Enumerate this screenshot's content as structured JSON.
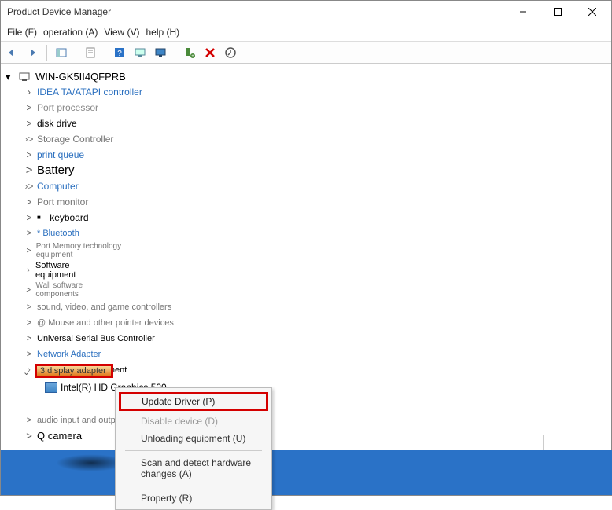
{
  "window": {
    "title": "Product Device Manager"
  },
  "menu": {
    "file": "File (F)",
    "operation": "operation (A)",
    "view": "View (V)",
    "help": "help (H)"
  },
  "root": {
    "name": "WIN-GK5II4QFPRB"
  },
  "nodes": {
    "idea": "IDEA TA/ATAPI controller",
    "portproc": "Port processor",
    "disk": "disk drive",
    "storage": "Storage Controller",
    "printq": "print queue",
    "battery": "Battery",
    "computer": "Computer",
    "portmon": "Port monitor",
    "keyboard": "keyboard",
    "bluetooth": "* Bluetooth",
    "memtech": "Port Memory technology equipment",
    "softeq": "Software equipment",
    "wallsoft": "Wall software components",
    "sound": "sound, video, and game controllers",
    "mouse": "@ Mouse and other pointer devices",
    "usb": "Universal Serial Bus Controller",
    "netadapter": "Network Adapter",
    "syseq": "Port System equipment",
    "display": "3 display adapter",
    "gpu": "Intel(R) HD Graphics 520",
    "audio": "audio input and output",
    "camera": "Q camera"
  },
  "context": {
    "update": "Update Driver (P)",
    "disable": "Disable device (D)",
    "unload": "Unloading equipment (U)",
    "scan": "Scan and detect hardware changes (A)",
    "property": "Property (R)"
  }
}
